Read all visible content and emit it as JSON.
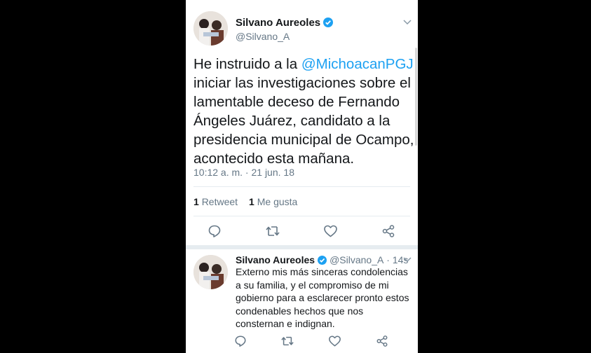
{
  "main_tweet": {
    "author_name": "Silvano Aureoles",
    "author_handle": "@Silvano_A",
    "text_before": "He instruido a la ",
    "mention": "@MichoacanPGJ",
    "text_after": " iniciar las investigaciones sobre el lamentable deceso de Fernando Ángeles Juárez, candidato a la presidencia municipal de Ocampo, acontecido esta mañana.",
    "timestamp": "10:12 a. m. · 21 jun. 18",
    "retweets_count": "1",
    "retweets_label": "Retweet",
    "likes_count": "1",
    "likes_label": "Me gusta"
  },
  "reply_tweet": {
    "author_name": "Silvano Aureoles",
    "author_handle": "@Silvano_A",
    "time": "· 14s",
    "text": "Externo mis más sinceras condolencias a su familia, y el compromiso de mi gobierno para a esclarecer pronto estos condenables hechos que nos consternan e indignan."
  },
  "icons": {
    "verified": "verified-badge-icon",
    "menu": "chevron-down-icon",
    "reply": "reply-icon",
    "retweet": "retweet-icon",
    "like": "heart-icon",
    "share": "share-icon"
  },
  "colors": {
    "link": "#1da1f2",
    "text": "#14171a",
    "secondary": "#657786",
    "icon": "#657786",
    "background": "#000000"
  }
}
